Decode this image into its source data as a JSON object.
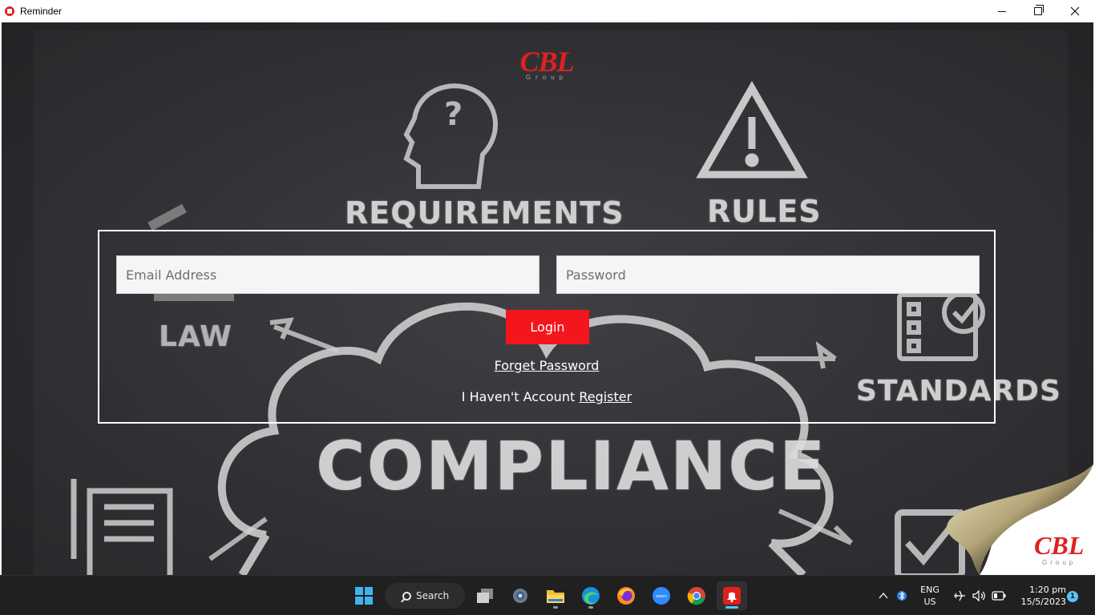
{
  "window": {
    "title": "Reminder"
  },
  "background": {
    "labels": {
      "requirements": "REQUIREMENTS",
      "rules": "RULES",
      "law": "LAW",
      "standards": "STANDARDS",
      "compliance": "COMPLIANCE"
    }
  },
  "logo": {
    "text": "CBL",
    "sub": "Group"
  },
  "login": {
    "email_placeholder": "Email Address",
    "password_placeholder": "Password",
    "login_label": "Login",
    "forget_label": "Forget Password",
    "no_account_text": "I Haven't Account ",
    "register_label": "Register"
  },
  "corner_logo": {
    "text": "CBL",
    "sub": "Group"
  },
  "taskbar": {
    "search_label": "Search",
    "apps": [
      "start-icon",
      "search",
      "task-view-icon",
      "settings-icon",
      "file-explorer-icon",
      "edge-icon",
      "firefox-icon",
      "zoom-icon",
      "chrome-icon",
      "reminder-app-icon"
    ],
    "zoom_label": "zoom",
    "language_line1": "ENG",
    "language_line2": "US",
    "time": "1:20 pm",
    "date": "15/5/2023",
    "notification_count": "1"
  },
  "colors": {
    "accent_red": "#f3161c",
    "taskbar_bg": "#202020",
    "board_bg": "#2c2c30"
  }
}
